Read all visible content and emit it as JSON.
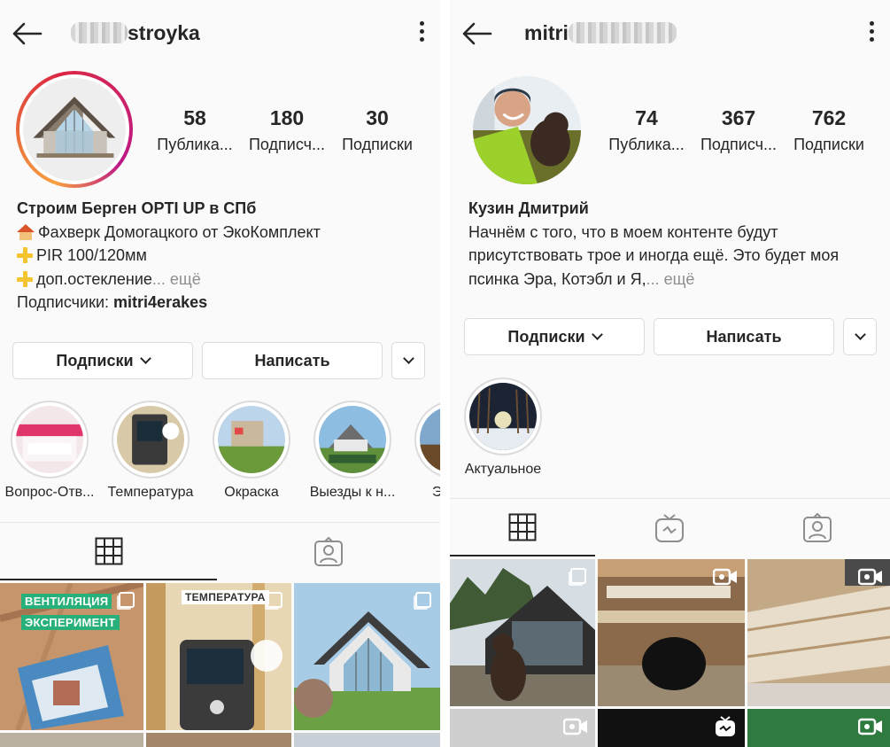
{
  "left": {
    "username_visible": "stroyka",
    "stats": [
      {
        "value": "58",
        "label": "Публика..."
      },
      {
        "value": "180",
        "label": "Подписч..."
      },
      {
        "value": "30",
        "label": "Подписки"
      }
    ],
    "bio": {
      "name": "Строим Берген OPTI UP в СПб",
      "line1": "Фахверк Домогацкого от ЭкоКомплект",
      "line2": "PIR 100/120мм",
      "line3": "доп.остекление",
      "line3_more": "... ещё",
      "followers_prefix": "Подписчики: ",
      "followers_name": "mitri4erakes"
    },
    "buttons": {
      "following": "Подписки",
      "message": "Написать"
    },
    "highlights": [
      {
        "caption": "Вопрос-Отв..."
      },
      {
        "caption": "Температура"
      },
      {
        "caption": "Окраска"
      },
      {
        "caption": "Выезды к н..."
      },
      {
        "caption": "Этап"
      }
    ],
    "grid_texts": {
      "vent1": "ВЕНТИЛЯЦИЯ",
      "vent2": "ЭКСПЕРИМЕНТ",
      "temp": "ТЕМПЕРАТУРА"
    }
  },
  "right": {
    "username_visible": "mitri",
    "stats": [
      {
        "value": "74",
        "label": "Публика..."
      },
      {
        "value": "367",
        "label": "Подписч..."
      },
      {
        "value": "762",
        "label": "Подписки"
      }
    ],
    "bio": {
      "name": "Кузин Дмитрий",
      "line1": "Начнём с того, что в моем контенте будут",
      "line2": "присутствовать трое и иногда ещё. Это будет моя",
      "line3": "псинка Эра, Котэбл и Я,",
      "line3_more": "... ещё"
    },
    "buttons": {
      "following": "Подписки",
      "message": "Написать"
    },
    "highlights": [
      {
        "caption": "Актуальное"
      }
    ]
  },
  "colors": {
    "text": "#262626",
    "muted": "#8e8e8e",
    "border": "#dbdbdb",
    "bg": "#fafafa"
  },
  "icons": [
    "back-arrow-icon",
    "more-options-icon",
    "chevron-down-icon",
    "grid-icon",
    "igtv-icon",
    "tagged-icon",
    "multi-photo-icon",
    "video-icon"
  ]
}
